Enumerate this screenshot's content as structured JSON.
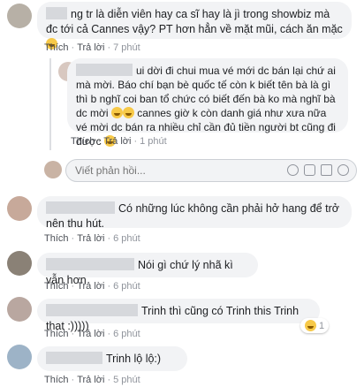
{
  "comments": [
    {
      "text": "ng tr là diễn viên hay ca sĩ hay là jì trong showbiz mà đc tới cả Cannes vậy? PT hơn hẳn về mặt mũi, cách ăn mặc",
      "like": "Thích",
      "reply": "Trả lời",
      "time": "7 phút"
    },
    {
      "text": "ui dời đi chui mua vé mới dc bán lại chứ ai mà mời. Báo chí bạn bè quốc tế còn k biết tên bà là gì thì b nghĩ coi ban tổ chức có biết đến bà ko mà nghĩ bà dc mời",
      "text2": "cannes giờ k còn danh giá như xưa nữa vé mời dc bán ra nhiều chỉ cần đủ tiền người bt cũng đi được",
      "like": "Thích",
      "reply": "Trả lời",
      "time": "1 phút"
    },
    {
      "text": "Có những lúc không cần phải hở hang để trở nên thu hút.",
      "like": "Thích",
      "reply": "Trả lời",
      "time": "6 phút"
    },
    {
      "text": "Nói gì chứ lý nhã kì vẫn hơn",
      "like": "Thích",
      "reply": "Trả lời",
      "time": "6 phút"
    },
    {
      "text": "Trinh thì cũng có Trinh this Trinh that :)))))",
      "like": "Thích",
      "reply": "Trả lời",
      "time": "6 phút",
      "reactions": "1"
    },
    {
      "text": "Trinh lộ lộ:)",
      "like": "Thích",
      "reply": "Trả lời",
      "time": "5 phút"
    }
  ],
  "reply_box": {
    "placeholder": "Viết phản hồi..."
  },
  "icons": [
    "smile-emoji-icon",
    "laugh-emoji-icon",
    "camera-icon",
    "gif-icon"
  ]
}
